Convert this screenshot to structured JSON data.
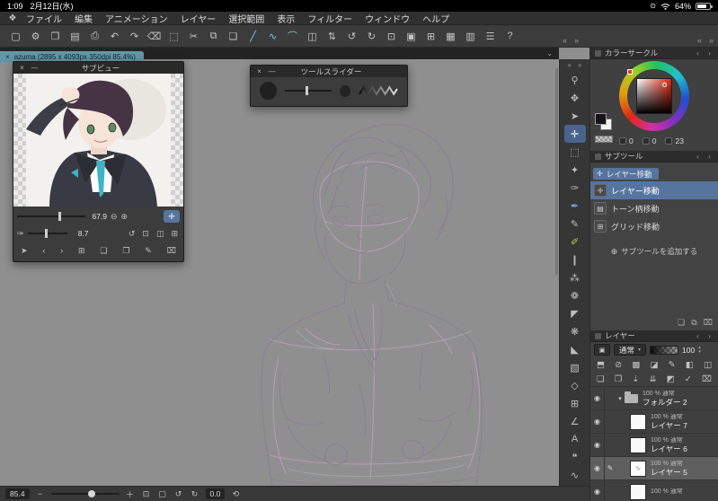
{
  "icons": {
    "logo": "❖",
    "close": "×",
    "minimize": "—",
    "chevron_down": "⌄",
    "collapse_left": "«",
    "collapse_right": "»",
    "panel_prev": "‹",
    "panel_next": "›",
    "eye": "◉",
    "disclosure": "▾",
    "edit_pencil": "✎",
    "combo_box": "▣",
    "dropdown": "▾",
    "zoom_out": "⊖",
    "zoom_in": "⊕",
    "move_cross": "✛",
    "add_circle": "⊕",
    "up": "▴",
    "down": "▾",
    "orientation_lock": "⊙",
    "minus": "−",
    "plus": "＋",
    "fit": "⊡",
    "actual_size": "▢",
    "rotate_left": "↺",
    "rotate_right": "↻",
    "reset": "⟲"
  },
  "status_bar": {
    "time": "1:09",
    "date": "2月12日(水)",
    "battery": "64%"
  },
  "menu_bar": {
    "items": [
      "ファイル",
      "編集",
      "アニメーション",
      "レイヤー",
      "選択範囲",
      "表示",
      "フィルター",
      "ウィンドウ",
      "ヘルプ"
    ]
  },
  "toolbar": {
    "icons": [
      {
        "name": "new-canvas-icon",
        "glyph": "▢"
      },
      {
        "name": "canvas-settings-icon",
        "glyph": "⚙"
      },
      {
        "name": "open-file-icon",
        "glyph": "❐"
      },
      {
        "name": "save-icon",
        "glyph": "▤"
      },
      {
        "name": "export-icon",
        "glyph": "⎙"
      },
      {
        "name": "undo-icon",
        "glyph": "↶"
      },
      {
        "name": "redo-icon",
        "glyph": "↷"
      },
      {
        "name": "clear-icon",
        "glyph": "⌫"
      },
      {
        "name": "deselect-icon",
        "glyph": "⬚"
      },
      {
        "name": "cut-icon",
        "glyph": "✂"
      },
      {
        "name": "copy-icon",
        "glyph": "⧉"
      },
      {
        "name": "paste-icon",
        "glyph": "❏"
      },
      {
        "name": "snap-ruler-icon",
        "glyph": "╱",
        "active": true
      },
      {
        "name": "snap-special-ruler-icon",
        "glyph": "∿",
        "active": true
      },
      {
        "name": "snap-grid-icon",
        "glyph": "⌒",
        "active": true
      },
      {
        "name": "flip-horizontal-icon",
        "glyph": "◫"
      },
      {
        "name": "flip-vertical-icon",
        "glyph": "⇅"
      },
      {
        "name": "rotate-left-icon",
        "glyph": "↺"
      },
      {
        "name": "rotate-right-icon",
        "glyph": "↻"
      },
      {
        "name": "fit-screen-icon",
        "glyph": "⊡"
      },
      {
        "name": "actual-size-icon",
        "glyph": "▣"
      },
      {
        "name": "show-grid-icon",
        "glyph": "⊞"
      },
      {
        "name": "material-panel-icon",
        "glyph": "▦"
      },
      {
        "name": "timeline-icon",
        "glyph": "▥"
      },
      {
        "name": "workspace-icon",
        "glyph": "☰"
      },
      {
        "name": "help-icon",
        "glyph": "?"
      }
    ]
  },
  "tab_bar": {
    "label": "azuma (2895 x 4093px 350dpi 85.4%)"
  },
  "tool_strip": {
    "tools": [
      {
        "name": "zoom-tool",
        "glyph": "⚲"
      },
      {
        "name": "hand-tool",
        "glyph": "✥"
      },
      {
        "name": "operation-tool",
        "glyph": "➤"
      },
      {
        "name": "layer-move-tool",
        "glyph": "✛",
        "selected": true
      },
      {
        "name": "selection-tool",
        "glyph": "⬚"
      },
      {
        "name": "auto-select-tool",
        "glyph": "✦"
      },
      {
        "name": "eyedropper-tool",
        "glyph": "✑"
      },
      {
        "name": "pen-tool",
        "glyph": "✒",
        "color": "#7f9fd8"
      },
      {
        "name": "pencil-tool",
        "glyph": "✎"
      },
      {
        "name": "marker-tool",
        "glyph": "✐",
        "color": "#b9c94a"
      },
      {
        "name": "brush-tool",
        "glyph": "❙"
      },
      {
        "name": "airbrush-tool",
        "glyph": "⁂"
      },
      {
        "name": "decoration-tool",
        "glyph": "❁"
      },
      {
        "name": "eraser-tool",
        "glyph": "◤"
      },
      {
        "name": "blend-tool",
        "glyph": "❋"
      },
      {
        "name": "fill-tool",
        "glyph": "◣"
      },
      {
        "name": "gradient-tool",
        "glyph": "▧"
      },
      {
        "name": "figure-tool",
        "glyph": "◇"
      },
      {
        "name": "frame-border-tool",
        "glyph": "⊞"
      },
      {
        "name": "ruler-tool",
        "glyph": "∠"
      },
      {
        "name": "text-tool",
        "glyph": "A"
      },
      {
        "name": "balloon-tool",
        "glyph": "❝"
      },
      {
        "name": "line-correct-tool",
        "glyph": "∿"
      }
    ]
  },
  "color_panel": {
    "title": "カラーサークル",
    "hsv": [
      "0",
      "0",
      "23"
    ]
  },
  "subtool_panel": {
    "title": "サブツール",
    "group_label": "レイヤー移動",
    "items": [
      {
        "glyph": "✛",
        "label": "レイヤー移動",
        "selected": true
      },
      {
        "glyph": "▤",
        "label": "トーン柄移動"
      },
      {
        "glyph": "⊞",
        "label": "グリッド移動"
      }
    ],
    "add_label": "サブツールを追加する",
    "footer_icons": [
      {
        "name": "add-subtool-icon",
        "glyph": "❏"
      },
      {
        "name": "duplicate-subtool-icon",
        "glyph": "⧉"
      },
      {
        "name": "delete-subtool-icon",
        "glyph": "⌧"
      }
    ]
  },
  "layer_panel": {
    "title": "レイヤー",
    "blend_mode": "通常",
    "opacity": "100",
    "mode_icons": [
      {
        "name": "clip-to-layer-below-icon",
        "glyph": "⬒"
      },
      {
        "name": "lock-layer-icon",
        "glyph": "⊘"
      },
      {
        "name": "lock-transparent-pixels-icon",
        "glyph": "▩"
      },
      {
        "name": "enable-mask-icon",
        "glyph": "◪"
      },
      {
        "name": "draft-layer-icon",
        "glyph": "✎"
      },
      {
        "name": "layer-color-icon",
        "glyph": "◧"
      },
      {
        "name": "divide-view-icon",
        "glyph": "◫"
      }
    ],
    "action_icons": [
      {
        "name": "new-raster-layer-icon",
        "glyph": "❏"
      },
      {
        "name": "new-folder-icon",
        "glyph": "❐"
      },
      {
        "name": "transfer-to-below-icon",
        "glyph": "⇣"
      },
      {
        "name": "merge-to-below-icon",
        "glyph": "⇊"
      },
      {
        "name": "create-mask-icon",
        "glyph": "◩"
      },
      {
        "name": "apply-mask-icon",
        "glyph": "✓"
      },
      {
        "name": "delete-layer-icon",
        "glyph": "⌧"
      }
    ],
    "layers": [
      {
        "info": "100 % 通常",
        "name": "フォルダー 2",
        "is_folder": true
      },
      {
        "info": "100 % 通常",
        "name": "レイヤー 7",
        "child": true
      },
      {
        "info": "100 % 通常",
        "name": "レイヤー 6",
        "child": true
      },
      {
        "info": "100 % 通常",
        "name": "レイヤー 5",
        "child": true,
        "selected": true
      },
      {
        "info": "100 % 通常",
        "name": "",
        "child": true
      }
    ]
  },
  "bottom_bar": {
    "zoom": "85.4",
    "rotation": "0.0"
  },
  "subview": {
    "title": "サブビュー",
    "zoom_value": "67.9",
    "secondary_value": "8.7",
    "row2_lead_icon": {
      "name": "eyedropper-toggle-icon",
      "glyph": "✑"
    },
    "row2_icons": [
      {
        "name": "rotate-reset-icon",
        "glyph": "↺"
      },
      {
        "name": "fit-view-icon",
        "glyph": "⊡"
      },
      {
        "name": "flip-view-icon",
        "glyph": "◫"
      },
      {
        "name": "overlay-icon",
        "glyph": "⊞"
      }
    ],
    "row3_icons": [
      {
        "name": "pointer-icon",
        "glyph": "➤"
      },
      {
        "name": "prev-image-icon",
        "glyph": "‹"
      },
      {
        "name": "next-image-icon",
        "glyph": "›"
      },
      {
        "name": "thumbnail-list-icon",
        "glyph": "⊞"
      },
      {
        "name": "open-file-icon",
        "glyph": "❏"
      },
      {
        "name": "add-image-icon",
        "glyph": "❐"
      },
      {
        "name": "edit-image-icon",
        "glyph": "✎"
      },
      {
        "name": "delete-image-icon",
        "glyph": "⌧"
      }
    ]
  },
  "tool_slider": {
    "title": "ツールスライダー"
  }
}
